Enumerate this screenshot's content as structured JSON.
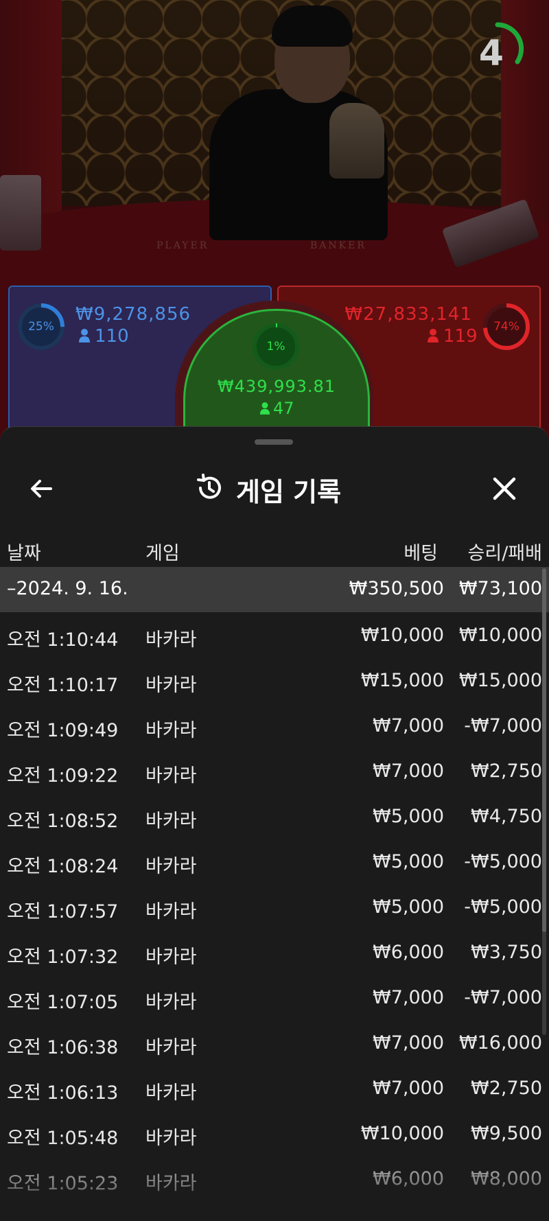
{
  "video": {
    "felt_player": "PLAYER",
    "felt_banker": "BANKER",
    "timer_value": "4",
    "timer_color": "#1fa83a"
  },
  "bets": {
    "player": {
      "percent": "25%",
      "amount": "₩9,278,856",
      "players": "110",
      "color": "#2f7fd8",
      "ring_fraction": 0.25
    },
    "tie": {
      "percent": "1%",
      "amount": "₩439,993.81",
      "players": "47",
      "color": "#2ee04a",
      "ring_fraction": 0.01
    },
    "banker": {
      "percent": "74%",
      "amount": "₩27,833,141",
      "players": "119",
      "color": "#e0252a",
      "ring_fraction": 0.74
    }
  },
  "sheet": {
    "title": "게임 기록",
    "back_icon": "arrow-left-icon",
    "history_icon": "history-icon",
    "close_icon": "close-icon",
    "columns": {
      "date": "날짜",
      "game": "게임",
      "bet": "베팅",
      "result": "승리/패배"
    },
    "date_group": {
      "label": "–2024. 9. 16.",
      "bet_total": "₩350,500",
      "result_total": "₩73,100"
    },
    "rows": [
      {
        "time": "오전 1:10:44",
        "game": "바카라",
        "bet": "₩10,000",
        "result": "₩10,000"
      },
      {
        "time": "오전 1:10:17",
        "game": "바카라",
        "bet": "₩15,000",
        "result": "₩15,000"
      },
      {
        "time": "오전 1:09:49",
        "game": "바카라",
        "bet": "₩7,000",
        "result": "-₩7,000"
      },
      {
        "time": "오전 1:09:22",
        "game": "바카라",
        "bet": "₩7,000",
        "result": "₩2,750"
      },
      {
        "time": "오전 1:08:52",
        "game": "바카라",
        "bet": "₩5,000",
        "result": "₩4,750"
      },
      {
        "time": "오전 1:08:24",
        "game": "바카라",
        "bet": "₩5,000",
        "result": "-₩5,000"
      },
      {
        "time": "오전 1:07:57",
        "game": "바카라",
        "bet": "₩5,000",
        "result": "-₩5,000"
      },
      {
        "time": "오전 1:07:32",
        "game": "바카라",
        "bet": "₩6,000",
        "result": "₩3,750"
      },
      {
        "time": "오전 1:07:05",
        "game": "바카라",
        "bet": "₩7,000",
        "result": "-₩7,000"
      },
      {
        "time": "오전 1:06:38",
        "game": "바카라",
        "bet": "₩7,000",
        "result": "₩16,000"
      },
      {
        "time": "오전 1:06:13",
        "game": "바카라",
        "bet": "₩7,000",
        "result": "₩2,750"
      },
      {
        "time": "오전 1:05:48",
        "game": "바카라",
        "bet": "₩10,000",
        "result": "₩9,500"
      },
      {
        "time": "오전 1:05:23",
        "game": "바카라",
        "bet": "₩6,000",
        "result": "₩8,000"
      }
    ]
  }
}
